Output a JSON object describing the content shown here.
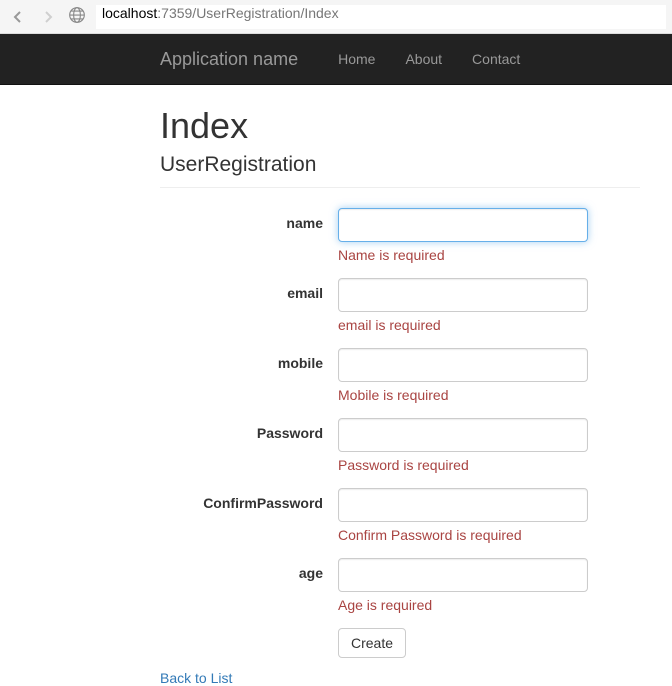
{
  "browser": {
    "url_host": "localhost",
    "url_rest": ":7359/UserRegistration/Index"
  },
  "navbar": {
    "brand": "Application name",
    "links": {
      "home": "Home",
      "about": "About",
      "contact": "Contact"
    }
  },
  "page": {
    "title": "Index",
    "subtitle": "UserRegistration"
  },
  "form": {
    "name": {
      "label": "name",
      "value": "",
      "error": "Name is required"
    },
    "email": {
      "label": "email",
      "value": "",
      "error": "email is required"
    },
    "mobile": {
      "label": "mobile",
      "value": "",
      "error": "Mobile is required"
    },
    "password": {
      "label": "Password",
      "value": "",
      "error": "Password is required"
    },
    "confirmPassword": {
      "label": "ConfirmPassword",
      "value": "",
      "error": "Confirm Password is required"
    },
    "age": {
      "label": "age",
      "value": "",
      "error": "Age is required"
    },
    "submit_label": "Create"
  },
  "back_link": "Back to List"
}
